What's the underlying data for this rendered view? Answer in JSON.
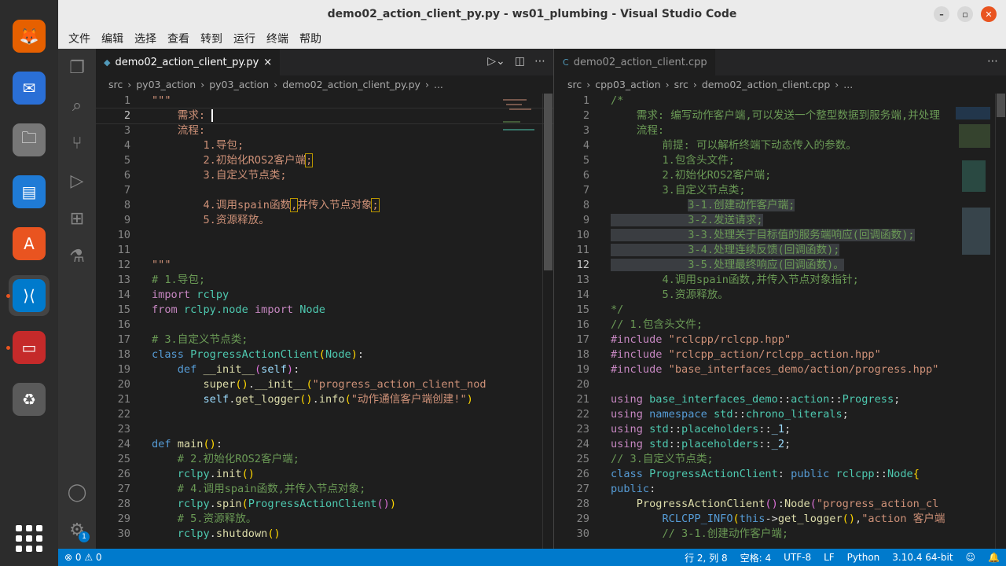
{
  "window": {
    "title": "demo02_action_client_py.py - ws01_plumbing - Visual Studio Code",
    "min": "–",
    "max": "▫",
    "close": "✕"
  },
  "menu": [
    "文件",
    "编辑",
    "选择",
    "查看",
    "转到",
    "运行",
    "终端",
    "帮助"
  ],
  "dock": [
    {
      "name": "firefox",
      "glyph": "🦊"
    },
    {
      "name": "thunderbird",
      "glyph": "✉"
    },
    {
      "name": "files",
      "glyph": "🗀"
    },
    {
      "name": "writer",
      "glyph": "▤"
    },
    {
      "name": "app-center",
      "glyph": "A"
    },
    {
      "name": "vscode",
      "glyph": "⟩⟨"
    },
    {
      "name": "terminal",
      "glyph": "▭"
    },
    {
      "name": "trash",
      "glyph": "♻"
    }
  ],
  "activity": {
    "settings_badge": "1"
  },
  "left": {
    "tab": "demo02_action_client_py.py",
    "tab_close": "×",
    "crumbs": [
      "src",
      "›",
      "py03_action",
      "›",
      "py03_action",
      "›",
      "demo02_action_client_py.py",
      "›",
      "..."
    ],
    "lines": [
      [
        [
          "str",
          "\"\"\""
        ]
      ],
      [
        [
          "str",
          "    需求: "
        ]
      ],
      [
        [
          "str",
          "    流程:"
        ]
      ],
      [
        [
          "str",
          "        1.导包;"
        ]
      ],
      [
        [
          "str",
          "        2.初始化ROS2客户端"
        ],
        [
          "str hl",
          ";"
        ]
      ],
      [
        [
          "str",
          "        3.自定义节点类;"
        ]
      ],
      [
        [
          "str",
          ""
        ]
      ],
      [
        [
          "str",
          "        4.调用spain函数"
        ],
        [
          "str hl",
          ","
        ],
        [
          "str",
          "并传入节点对象"
        ],
        [
          "str hl",
          ";"
        ]
      ],
      [
        [
          "str",
          "        5.资源释放。"
        ]
      ],
      [
        [
          "def",
          ""
        ]
      ],
      [
        [
          "def",
          ""
        ]
      ],
      [
        [
          "str",
          "\"\"\""
        ]
      ],
      [
        [
          "com",
          "# 1.导包;"
        ]
      ],
      [
        [
          "kw",
          "import "
        ],
        [
          "ty",
          "rclpy"
        ]
      ],
      [
        [
          "kw",
          "from "
        ],
        [
          "ty",
          "rclpy.node "
        ],
        [
          "kw",
          "import "
        ],
        [
          "ty",
          "Node"
        ]
      ],
      [
        [
          "def",
          ""
        ]
      ],
      [
        [
          "com",
          "# 3.自定义节点类;"
        ]
      ],
      [
        [
          "bl",
          "class "
        ],
        [
          "ty",
          "ProgressActionClient"
        ],
        [
          "pu",
          "("
        ],
        [
          "ty",
          "Node"
        ],
        [
          "pu",
          ")"
        ],
        [
          "def",
          ":"
        ]
      ],
      [
        [
          "bl",
          "    def "
        ],
        [
          "fn",
          "__init__"
        ],
        [
          "pr",
          "("
        ],
        [
          "var",
          "self"
        ],
        [
          "pr",
          ")"
        ],
        [
          "def",
          ":"
        ]
      ],
      [
        [
          "fn",
          "        super"
        ],
        [
          "pu",
          "()"
        ],
        [
          "def",
          "."
        ],
        [
          "fn",
          "__init__"
        ],
        [
          "pu",
          "("
        ],
        [
          "str",
          "\"progress_action_client_nod"
        ]
      ],
      [
        [
          "var",
          "        self"
        ],
        [
          "def",
          "."
        ],
        [
          "fn",
          "get_logger"
        ],
        [
          "pu",
          "()"
        ],
        [
          "def",
          "."
        ],
        [
          "fn",
          "info"
        ],
        [
          "pu",
          "("
        ],
        [
          "str",
          "\"动作通信客户端创建!\""
        ],
        [
          "pu",
          ")"
        ]
      ],
      [
        [
          "def",
          ""
        ]
      ],
      [
        [
          "def",
          ""
        ]
      ],
      [
        [
          "bl",
          "def "
        ],
        [
          "fn",
          "main"
        ],
        [
          "pu",
          "()"
        ],
        [
          "def",
          ":"
        ]
      ],
      [
        [
          "com",
          "    # 2.初始化ROS2客户端;"
        ]
      ],
      [
        [
          "ty",
          "    rclpy"
        ],
        [
          "def",
          "."
        ],
        [
          "fn",
          "init"
        ],
        [
          "pu",
          "()"
        ]
      ],
      [
        [
          "com",
          "    # 4.调用spain函数,并传入节点对象;"
        ]
      ],
      [
        [
          "ty",
          "    rclpy"
        ],
        [
          "def",
          "."
        ],
        [
          "fn",
          "spin"
        ],
        [
          "pu",
          "("
        ],
        [
          "ty",
          "ProgressActionClient"
        ],
        [
          "pr",
          "()"
        ],
        [
          "pu",
          ")"
        ]
      ],
      [
        [
          "com",
          "    # 5.资源释放。"
        ]
      ],
      [
        [
          "ty",
          "    rclpy"
        ],
        [
          "def",
          "."
        ],
        [
          "fn",
          "shutdown"
        ],
        [
          "pu",
          "()"
        ]
      ]
    ]
  },
  "right": {
    "tab": "demo02_action_client.cpp",
    "crumbs": [
      "src",
      "›",
      "cpp03_action",
      "›",
      "src",
      "›",
      "demo02_action_client.cpp",
      "›",
      "..."
    ],
    "lines": [
      [
        [
          "com",
          "/*"
        ]
      ],
      [
        [
          "com",
          "    需求: 编写动作客户端,可以发送一个整型数据到服务端,并处理"
        ]
      ],
      [
        [
          "com",
          "    流程:"
        ]
      ],
      [
        [
          "com",
          "        前提: 可以解析终端下动态传入的参数。"
        ]
      ],
      [
        [
          "com",
          "        1.包含头文件;"
        ]
      ],
      [
        [
          "com",
          "        2.初始化ROS2客户端;"
        ]
      ],
      [
        [
          "com",
          "        3.自定义节点类;"
        ]
      ],
      [
        [
          "com",
          "            "
        ],
        [
          "com sel",
          "3-1.创建动作客户端;"
        ]
      ],
      [
        [
          "com sel",
          "            3-2.发送请求;"
        ]
      ],
      [
        [
          "com sel",
          "            3-3.处理关于目标值的服务端响应(回调函数);"
        ]
      ],
      [
        [
          "com sel",
          "            3-4.处理连续反馈(回调函数);"
        ]
      ],
      [
        [
          "com sel",
          "            3-5.处理最终响应(回调函数)。"
        ]
      ],
      [
        [
          "com",
          "        4.调用spain函数,并传入节点对象指针;"
        ]
      ],
      [
        [
          "com",
          "        5.资源释放。"
        ]
      ],
      [
        [
          "com",
          "*/"
        ]
      ],
      [
        [
          "com",
          "// 1.包含头文件;"
        ]
      ],
      [
        [
          "kw",
          "#include "
        ],
        [
          "str",
          "\"rclcpp/rclcpp.hpp\""
        ]
      ],
      [
        [
          "kw",
          "#include "
        ],
        [
          "str",
          "\"rclcpp_action/rclcpp_action.hpp\""
        ]
      ],
      [
        [
          "kw",
          "#include "
        ],
        [
          "str",
          "\"base_interfaces_demo/action/progress.hpp\""
        ]
      ],
      [
        [
          "def",
          ""
        ]
      ],
      [
        [
          "kw",
          "using "
        ],
        [
          "ty",
          "base_interfaces_demo"
        ],
        [
          "def",
          "::"
        ],
        [
          "ty",
          "action"
        ],
        [
          "def",
          "::"
        ],
        [
          "ty",
          "Progress"
        ],
        [
          "def",
          ";"
        ]
      ],
      [
        [
          "kw",
          "using "
        ],
        [
          "bl",
          "namespace "
        ],
        [
          "ty",
          "std"
        ],
        [
          "def",
          "::"
        ],
        [
          "ty",
          "chrono_literals"
        ],
        [
          "def",
          ";"
        ]
      ],
      [
        [
          "kw",
          "using "
        ],
        [
          "ty",
          "std"
        ],
        [
          "def",
          "::"
        ],
        [
          "ty",
          "placeholders"
        ],
        [
          "def",
          "::"
        ],
        [
          "var",
          "_1"
        ],
        [
          "def",
          ";"
        ]
      ],
      [
        [
          "kw",
          "using "
        ],
        [
          "ty",
          "std"
        ],
        [
          "def",
          "::"
        ],
        [
          "ty",
          "placeholders"
        ],
        [
          "def",
          "::"
        ],
        [
          "var",
          "_2"
        ],
        [
          "def",
          ";"
        ]
      ],
      [
        [
          "com",
          "// 3.自定义节点类;"
        ]
      ],
      [
        [
          "bl",
          "class "
        ],
        [
          "ty",
          "ProgressActionClient"
        ],
        [
          "def",
          ": "
        ],
        [
          "bl",
          "public "
        ],
        [
          "ty",
          "rclcpp"
        ],
        [
          "def",
          "::"
        ],
        [
          "ty",
          "Node"
        ],
        [
          "pu",
          "{"
        ]
      ],
      [
        [
          "bl",
          "public"
        ],
        [
          "def",
          ":"
        ]
      ],
      [
        [
          "fn",
          "    ProgressActionClient"
        ],
        [
          "pr",
          "()"
        ],
        [
          "def",
          ":"
        ],
        [
          "fn",
          "Node"
        ],
        [
          "pr",
          "("
        ],
        [
          "str",
          "\"progress_action_cl"
        ]
      ],
      [
        [
          "bl",
          "        RCLCPP_INFO"
        ],
        [
          "pu",
          "("
        ],
        [
          "bl",
          "this"
        ],
        [
          "def",
          "->"
        ],
        [
          "fn",
          "get_logger"
        ],
        [
          "pu",
          "()"
        ],
        [
          "def",
          ","
        ],
        [
          "str",
          "\"action 客户端"
        ]
      ],
      [
        [
          "com",
          "        // 3-1.创建动作客户端;"
        ]
      ]
    ]
  },
  "status": {
    "problems": "⊗ 0 ⚠ 0",
    "position": "行 2, 列 8",
    "indent": "空格: 4",
    "encoding": "UTF-8",
    "eol": "LF",
    "language": "Python",
    "interpreter": "3.10.4 64-bit",
    "feedback": "☺",
    "bell": "🔔"
  }
}
